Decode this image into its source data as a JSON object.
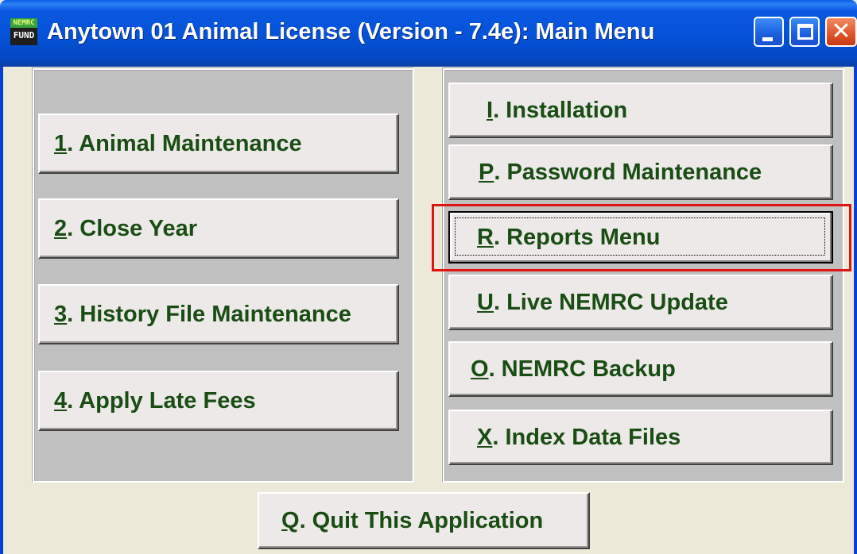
{
  "window": {
    "title": "Anytown 01 Animal License (Version - 7.4e):  Main Menu",
    "icon": {
      "name": "nemrc-fund-icon",
      "top_text": "NEMRC",
      "bottom_text": "FUND"
    }
  },
  "titlebar_buttons": [
    {
      "name": "minimize-button",
      "icon": "minimize-icon"
    },
    {
      "name": "maximize-button",
      "icon": "maximize-icon"
    },
    {
      "name": "close-button",
      "icon": "close-icon",
      "glyph": "✕"
    }
  ],
  "left_menu": [
    {
      "key": "1",
      "label": ". Animal Maintenance"
    },
    {
      "key": "2",
      "label": ".  Close Year"
    },
    {
      "key": "3",
      "label": ".  History File Maintenance"
    },
    {
      "key": "4",
      "label": ".  Apply Late Fees"
    }
  ],
  "right_menu": [
    {
      "key": "I",
      "label": ".  Installation"
    },
    {
      "key": "P",
      "label": ".  Password Maintenance"
    },
    {
      "key": "R",
      "label": ".  Reports Menu",
      "focused": true
    },
    {
      "key": "U",
      "label": ". Live NEMRC Update"
    },
    {
      "key": "O",
      "label": ". NEMRC Backup"
    },
    {
      "key": "X",
      "label": ".  Index Data Files"
    }
  ],
  "quit_button": {
    "key": "Q",
    "label": ".  Quit This Application"
  },
  "colors": {
    "button_text": "#1a4d14",
    "highlight_box": "#e11414",
    "titlebar": "#0553d9"
  }
}
